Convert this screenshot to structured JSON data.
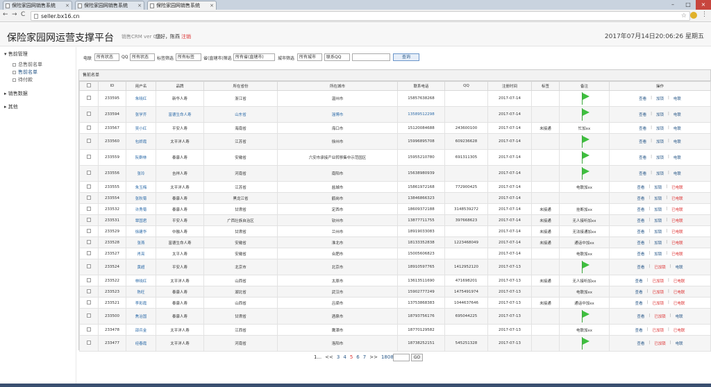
{
  "browser": {
    "tabs": [
      "保险家园网销售系统",
      "保险家园网销售系统",
      "保险家园网销售系统"
    ],
    "url": "seller.bx16.cn",
    "back": "←",
    "forward": "→",
    "reload": "C"
  },
  "header": {
    "brand": "保险家园网运营支撑平台",
    "version": "销售CRM ver 0.8",
    "greeting": "您好，陈燕",
    "logout": "注销",
    "datetime": "2017年07月14日20:06:26 星期五"
  },
  "sidebar": {
    "group1": "售前管理",
    "items": [
      "总售前名单",
      "售前名单",
      "待付款"
    ],
    "group2": "销售数据",
    "group3": "其他"
  },
  "filters": {
    "l1": "电联",
    "s1": "所有状态",
    "l2": "QQ",
    "s2": "所有状态",
    "l3": "标签筛选",
    "s3": "所有标签",
    "l4": "省(直辖市)筛选",
    "s4": "所有省(直辖市)",
    "l5": "城市筛选",
    "s5": "所有城市",
    "s6": "联系QQ",
    "search": "查询"
  },
  "panel_title": "售前名单",
  "table": {
    "headers": [
      "",
      "ID",
      "用户名",
      "品牌",
      "所在省份",
      "所在城市",
      "联系电话",
      "QQ",
      "注册时间",
      "标签",
      "备注",
      "操作"
    ],
    "rows": [
      {
        "id": "233595",
        "name": "朱晓红",
        "brand": "新华人寿",
        "prov": "浙江省",
        "city": "温州市",
        "phone": "15857638268",
        "qq": "",
        "date": "2017-07-14",
        "tag": "",
        "note": "",
        "flag": true,
        "ops": [
          "查看",
          "加锁",
          "电联"
        ],
        "red": []
      },
      {
        "id": "233594",
        "name": "张学齐",
        "brand": "富德生命人寿",
        "prov": "山东省",
        "city": "淄博市",
        "phone": "13589512298",
        "qq": "",
        "date": "2017-07-14",
        "tag": "",
        "note": "",
        "flag": true,
        "ops": [
          "查看",
          "加锁",
          "电联"
        ],
        "red": [],
        "hl": true
      },
      {
        "id": "233567",
        "name": "吴小红",
        "brand": "平安人寿",
        "prov": "海南省",
        "city": "海口市",
        "phone": "15120084688",
        "qq": "243600100",
        "date": "2017-07-14",
        "tag": "未接通",
        "note": "忙加xx",
        "flag": false,
        "ops": [
          "查看",
          "加锁",
          "电联"
        ],
        "red": []
      },
      {
        "id": "233560",
        "name": "包娇霞",
        "brand": "太平洋人寿",
        "prov": "江苏省",
        "city": "徐州市",
        "phone": "15996895708",
        "qq": "609236628",
        "date": "2017-07-14",
        "tag": "",
        "note": "",
        "flag": true,
        "ops": [
          "查看",
          "加锁",
          "电联"
        ],
        "red": []
      },
      {
        "id": "233559",
        "name": "阮群林",
        "brand": "泰康人寿",
        "prov": "安徽省",
        "city": "六安市承接产业转移集中示范园区",
        "phone": "15955210780",
        "qq": "691311305",
        "date": "2017-07-14",
        "tag": "",
        "note": "",
        "flag": true,
        "ops": [
          "查看",
          "加锁",
          "电联"
        ],
        "red": []
      },
      {
        "id": "233556",
        "name": "张玲",
        "brand": "吉祥人寿",
        "prov": "河南省",
        "city": "南阳市",
        "phone": "15638980939",
        "qq": "",
        "date": "2017-07-14",
        "tag": "",
        "note": "",
        "flag": true,
        "ops": [
          "查看",
          "加锁",
          "电联"
        ],
        "red": []
      },
      {
        "id": "233555",
        "name": "朱玉梅",
        "brand": "太平洋人寿",
        "prov": "江苏省",
        "city": "盐城市",
        "phone": "15861972168",
        "qq": "772900425",
        "date": "2017-07-14",
        "tag": "",
        "note": "电联加xx",
        "flag": false,
        "ops": [
          "查看",
          "加锁",
          "已电联"
        ],
        "red": [
          2
        ]
      },
      {
        "id": "233554",
        "name": "张秋菊",
        "brand": "泰康人寿",
        "prov": "黑龙江省",
        "city": "鹤岗市",
        "phone": "13846866323",
        "qq": "",
        "date": "2017-07-14",
        "tag": "",
        "note": "",
        "flag": false,
        "ops": [
          "查看",
          "加锁",
          "已电联"
        ],
        "red": [
          2
        ]
      },
      {
        "id": "233532",
        "name": "许秀菊",
        "brand": "泰康人寿",
        "prov": "甘肃省",
        "city": "定西市",
        "phone": "18609372188",
        "qq": "3148539272",
        "date": "2017-07-14",
        "tag": "未接通",
        "note": "挂断加xx",
        "flag": false,
        "ops": [
          "查看",
          "加锁",
          "已电联"
        ],
        "red": [
          2
        ]
      },
      {
        "id": "233531",
        "name": "覃国君",
        "brand": "平安人寿",
        "prov": "广西壮族自治区",
        "city": "钦州市",
        "phone": "13877711755",
        "qq": "397668623",
        "date": "2017-07-14",
        "tag": "未接通",
        "note": "无人接听加xx",
        "flag": false,
        "ops": [
          "查看",
          "加锁",
          "已电联"
        ],
        "red": [
          2
        ]
      },
      {
        "id": "233529",
        "name": "徐建华",
        "brand": "中融人寿",
        "prov": "甘肃省",
        "city": "兰州市",
        "phone": "18919033083",
        "qq": "",
        "date": "2017-07-14",
        "tag": "未接通",
        "note": "无法接通加xx",
        "flag": false,
        "ops": [
          "查看",
          "加锁",
          "已电联"
        ],
        "red": [
          2
        ]
      },
      {
        "id": "233528",
        "name": "张燕",
        "brand": "富德生命人寿",
        "prov": "安徽省",
        "city": "淮北市",
        "phone": "18133352838",
        "qq": "1223468049",
        "date": "2017-07-14",
        "tag": "未接通",
        "note": "通话中加xx",
        "flag": false,
        "ops": [
          "查看",
          "加锁",
          "已电联"
        ],
        "red": [
          2
        ]
      },
      {
        "id": "233527",
        "name": "肖亮",
        "brand": "太平人寿",
        "prov": "安徽省",
        "city": "合肥市",
        "phone": "15005606823",
        "qq": "",
        "date": "2017-07-14",
        "tag": "",
        "note": "电联加xx",
        "flag": false,
        "ops": [
          "查看",
          "加锁",
          "已电联"
        ],
        "red": [
          2
        ]
      },
      {
        "id": "233524",
        "name": "黄超",
        "brand": "平安人寿",
        "prov": "北京市",
        "city": "北京市",
        "phone": "18910597765",
        "qq": "1412952120",
        "date": "2017-07-13",
        "tag": "",
        "note": "",
        "flag": true,
        "ops": [
          "查看",
          "已加锁",
          "电联"
        ],
        "red": [
          1
        ]
      },
      {
        "id": "233522",
        "name": "林晓红",
        "brand": "太平洋人寿",
        "prov": "山西省",
        "city": "太原市",
        "phone": "13613511690",
        "qq": "471698201",
        "date": "2017-07-13",
        "tag": "未接通",
        "note": "无人接听加xx",
        "flag": false,
        "ops": [
          "查看",
          "已加锁",
          "已电联"
        ],
        "red": [
          1,
          2
        ]
      },
      {
        "id": "233523",
        "name": "陈旺",
        "brand": "泰康人寿",
        "prov": "湖北省",
        "city": "武汉市",
        "phone": "15902777249",
        "qq": "1475491974",
        "date": "2017-07-13",
        "tag": "",
        "note": "电联加xx",
        "flag": false,
        "ops": [
          "查看",
          "已加锁",
          "已电联"
        ],
        "red": [
          1,
          2
        ]
      },
      {
        "id": "233521",
        "name": "李彩霞",
        "brand": "泰康人寿",
        "prov": "山西省",
        "city": "吕梁市",
        "phone": "13753868383",
        "qq": "1044637646",
        "date": "2017-07-13",
        "tag": "未接通",
        "note": "通话中加xx",
        "flag": false,
        "ops": [
          "查看",
          "已加锁",
          "已电联"
        ],
        "red": [
          1,
          2
        ]
      },
      {
        "id": "233500",
        "name": "焦治国",
        "brand": "泰康人寿",
        "prov": "甘肃省",
        "city": "酒泉市",
        "phone": "18793756176",
        "qq": "695044225",
        "date": "2017-07-13",
        "tag": "",
        "note": "",
        "flag": true,
        "ops": [
          "查看",
          "已加锁",
          "电联"
        ],
        "red": [
          1
        ]
      },
      {
        "id": "233478",
        "name": "邵兵金",
        "brand": "太平洋人寿",
        "prov": "江西省",
        "city": "鹰潭市",
        "phone": "18770129582",
        "qq": "",
        "date": "2017-07-13",
        "tag": "",
        "note": "电联加xx",
        "flag": false,
        "ops": [
          "查看",
          "已加锁",
          "已电联"
        ],
        "red": [
          1,
          2
        ]
      },
      {
        "id": "233477",
        "name": "经春霞",
        "brand": "太平洋人寿",
        "prov": "河南省",
        "city": "洛阳市",
        "phone": "18738252151",
        "qq": "545251328",
        "date": "2017-07-13",
        "tag": "",
        "note": "",
        "flag": true,
        "ops": [
          "查看",
          "已加锁",
          "电联"
        ],
        "red": [
          1
        ]
      }
    ]
  },
  "pager": {
    "items": [
      "1...",
      "<<",
      "3",
      "4",
      "5",
      "6",
      "7",
      ">>",
      "1808"
    ],
    "current": "5",
    "go": "GO"
  },
  "colors": {
    "accent": "#2b5a8a",
    "red": "#dd3333",
    "flag": "#3fbf3f"
  }
}
